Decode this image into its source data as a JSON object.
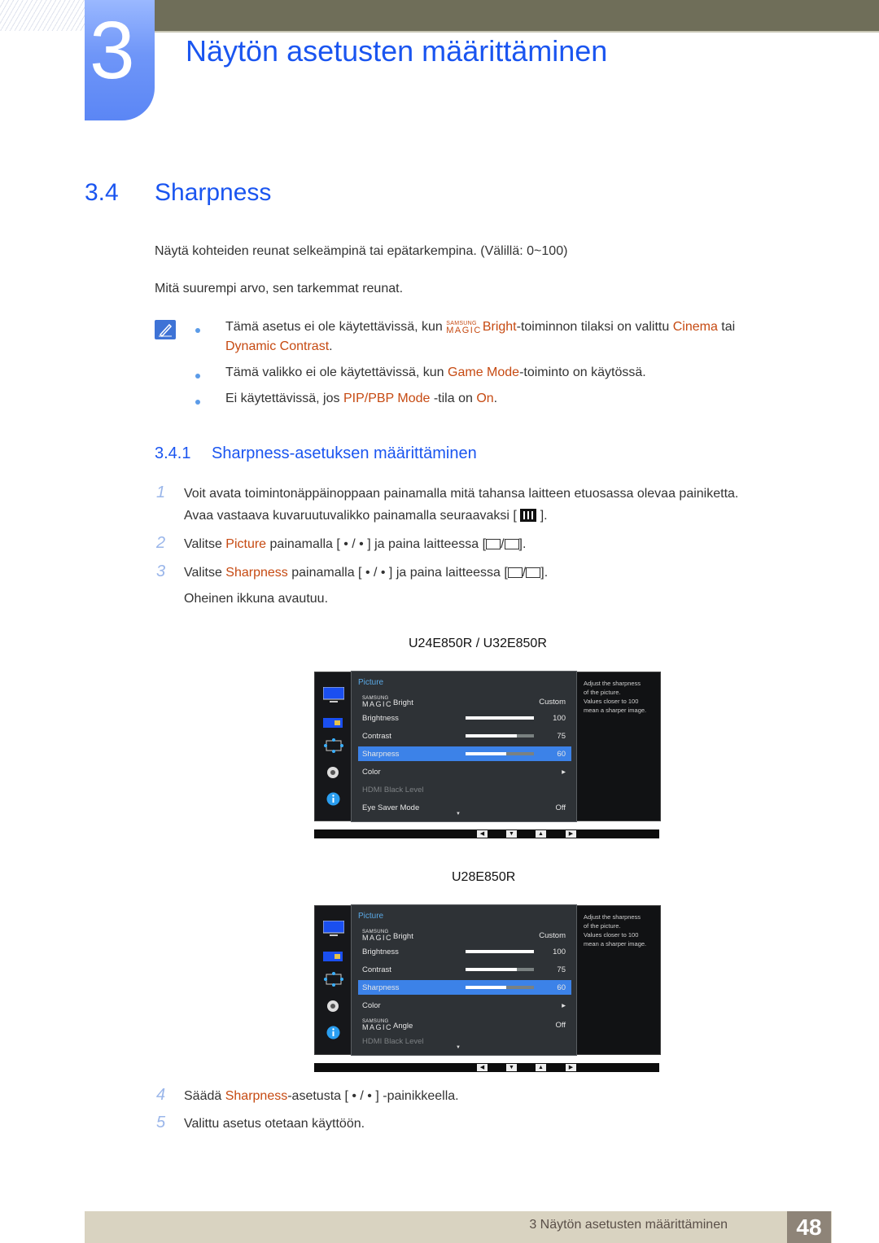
{
  "chapter": {
    "number": "3",
    "title": "Näytön asetusten määrittäminen"
  },
  "section": {
    "number": "3.4",
    "title": "Sharpness"
  },
  "intro": [
    "Näytä kohteiden reunat selkeämpinä tai epätarkempina. (Välillä: 0~100)",
    "Mitä suurempi arvo, sen tarkemmat reunat."
  ],
  "notes": {
    "note1": {
      "pre": "Tämä asetus ei ole käytettävissä, kun ",
      "magic_small": "SAMSUNG",
      "magic_big": "MAGIC",
      "term": "Bright",
      "mid": "-toiminnon tilaksi on valittu ",
      "term2": "Cinema",
      "post": " tai",
      "term3": "Dynamic Contrast",
      "end": "."
    },
    "note2": {
      "pre": "Tämä valikko ei ole käytettävissä, kun ",
      "term": "Game Mode",
      "post": "-toiminto on käytössä."
    },
    "note3": {
      "pre": "Ei käytettävissä, jos ",
      "term": "PIP/PBP Mode",
      "mid": " -tila on ",
      "term2": "On",
      "post": "."
    }
  },
  "subsection": {
    "number": "3.4.1",
    "title": "Sharpness-asetuksen määrittäminen"
  },
  "steps": {
    "s1": {
      "num": "1",
      "line1": "Voit avata toimintonäppäinoppaan painamalla mitä tahansa laitteen etuosassa olevaa painiketta.",
      "line2_pre": "Avaa vastaava kuvaruutuvalikko painamalla seuraavaksi [",
      "line2_post": "]."
    },
    "s2": {
      "num": "2",
      "pre": "Valitse ",
      "term": "Picture",
      "mid": " painamalla [ • / • ] ja paina laitteessa [",
      "sep": "/",
      "post": "]."
    },
    "s3": {
      "num": "3",
      "pre": "Valitse ",
      "term": "Sharpness",
      "mid": " painamalla [ • / • ] ja paina laitteessa [",
      "sep": "/",
      "post": "].",
      "line2": "Oheinen ikkuna avautuu."
    },
    "s4": {
      "num": "4",
      "pre": "Säädä ",
      "term": "Sharpness",
      "post": "-asetusta [ • / • ] -painikkeella."
    },
    "s5": {
      "num": "5",
      "text": "Valittu asetus otetaan käyttöön."
    }
  },
  "osd1": {
    "model": "U24E850R / U32E850R",
    "header": "Picture",
    "rows": [
      {
        "magic_small": "SAMSUNG",
        "magic_big": "MAGIC",
        "label": "Bright",
        "value": "Custom"
      },
      {
        "label": "Brightness",
        "value": "100",
        "level": 100
      },
      {
        "label": "Contrast",
        "value": "75",
        "level": 75
      },
      {
        "label": "Sharpness",
        "value": "60",
        "level": 60,
        "selected": true
      },
      {
        "label": "Color",
        "value": "▸"
      },
      {
        "label": "HDMI Black Level",
        "value": "",
        "disabled": true
      },
      {
        "label": "Eye Saver Mode",
        "value": "Off"
      }
    ],
    "description": [
      "Adjust the sharpness",
      "of the picture.",
      "Values closer to 100",
      "mean a sharper image."
    ]
  },
  "osd2": {
    "model": "U28E850R",
    "header": "Picture",
    "rows": [
      {
        "magic_small": "SAMSUNG",
        "magic_big": "MAGIC",
        "label": "Bright",
        "value": "Custom"
      },
      {
        "label": "Brightness",
        "value": "100",
        "level": 100
      },
      {
        "label": "Contrast",
        "value": "75",
        "level": 75
      },
      {
        "label": "Sharpness",
        "value": "60",
        "level": 60,
        "selected": true
      },
      {
        "label": "Color",
        "value": "▸"
      },
      {
        "magic_small": "SAMSUNG",
        "magic_big": "MAGIC",
        "label": "Angle",
        "value": "Off"
      },
      {
        "label": "HDMI Black Level",
        "value": "",
        "disabled": true
      }
    ],
    "description": [
      "Adjust the sharpness",
      "of the picture.",
      "Values closer to 100",
      "mean a sharper image."
    ]
  },
  "nav_keys": [
    "◀",
    "▼",
    "▲",
    "▶"
  ],
  "footer": {
    "text": "3 Näytön asetusten määrittäminen",
    "page": "48"
  }
}
